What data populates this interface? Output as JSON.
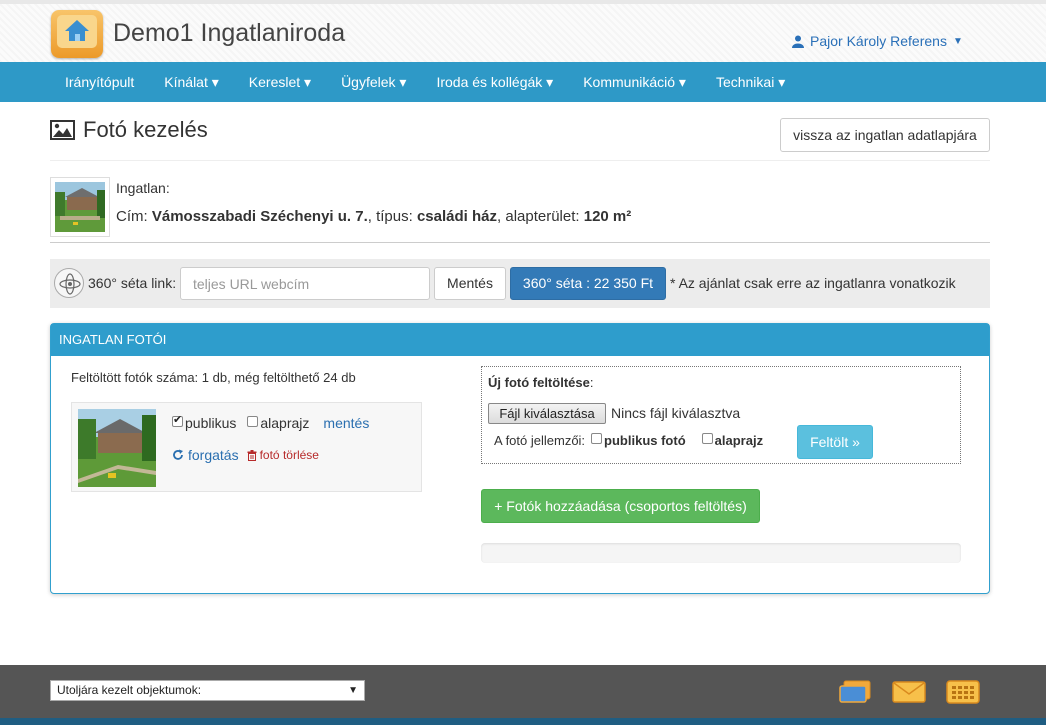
{
  "header": {
    "brand": "Demo1 Ingatlaniroda",
    "user": "Pajor Károly Referens"
  },
  "nav": {
    "items": [
      "Irányítópult",
      "Kínálat ▾",
      "Kereslet ▾",
      "Ügyfelek ▾",
      "Iroda és kollégák ▾",
      "Kommunikáció ▾",
      "Technikai ▾"
    ]
  },
  "page": {
    "title": "Fotó kezelés",
    "back_button": "vissza az ingatlan adatlapjára"
  },
  "property": {
    "label": "Ingatlan:",
    "address_label": "Cím: ",
    "address": "Vámosszabadi Széchenyi u. 7.",
    "type_label": ", típus: ",
    "type": "családi ház",
    "area_label": ", alapterület: ",
    "area": "120 m²"
  },
  "tour": {
    "label": "360° séta link:",
    "placeholder": "teljes URL webcím",
    "save": "Mentés",
    "buy": "360° séta : 22 350 Ft",
    "note": "* Az ajánlat csak erre az ingatlanra vonatkozik"
  },
  "panel": {
    "title": "INGATLAN FOTÓI",
    "uploaded": "Feltöltött fotók száma: 1 db, még feltölthető 24 db",
    "photo": {
      "public_label": "publikus",
      "public_checked": true,
      "plan_label": "alaprajz",
      "plan_checked": false,
      "save": "mentés",
      "rotate": "forgatás",
      "delete": "fotó törlése"
    },
    "upload": {
      "title": "Új fotó feltöltése",
      "title_suffix": ":",
      "file_button": "Fájl kiválasztása",
      "file_none": "Nincs fájl kiválasztva",
      "props_label": "A fotó jellemzői:",
      "public_label": "publikus fotó",
      "plan_label": "alaprajz",
      "submit": "Feltölt »"
    },
    "group_upload": "+ Fotók hozzáadása (csoportos feltöltés)"
  },
  "footer": {
    "recent": "Utoljára kezelt objektumok:"
  },
  "colors": {
    "nav": "#2e99c7",
    "primary": "#337ab7",
    "info": "#5bc0de",
    "success": "#5cb85c",
    "footer": "#555555"
  },
  "icons": [
    "home-icon",
    "user-icon",
    "image-icon",
    "tour-360-icon",
    "rotate-icon",
    "trash-icon",
    "cards-icon",
    "envelope-icon",
    "keypad-icon"
  ]
}
